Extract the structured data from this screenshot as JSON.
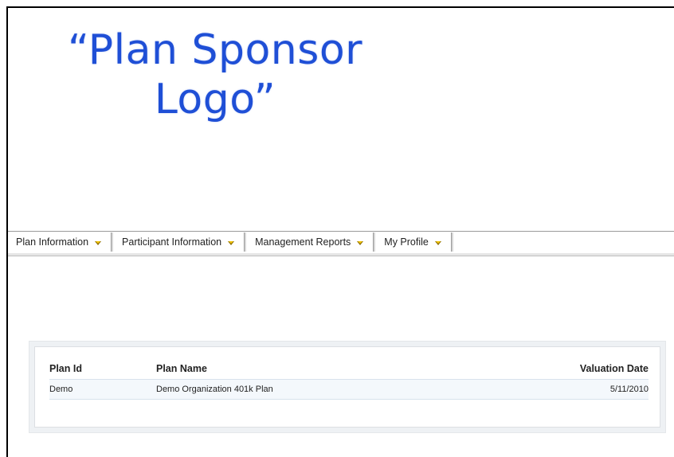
{
  "logo": {
    "line1": "“Plan Sponsor",
    "line2": "Logo”"
  },
  "nav": {
    "items": [
      {
        "label": "Plan Information"
      },
      {
        "label": "Participant Information"
      },
      {
        "label": "Management Reports"
      },
      {
        "label": "My Profile"
      }
    ]
  },
  "plans_table": {
    "headers": {
      "plan_id": "Plan Id",
      "plan_name": "Plan Name",
      "valuation_date": "Valuation Date"
    },
    "rows": [
      {
        "plan_id": "Demo",
        "plan_name": "Demo Organization 401k Plan",
        "valuation_date": "5/11/2010"
      }
    ]
  },
  "colors": {
    "logo_blue": "#1f4fd6",
    "caret_yellow": "#f2c400",
    "row_highlight": "#f4f8fc"
  }
}
